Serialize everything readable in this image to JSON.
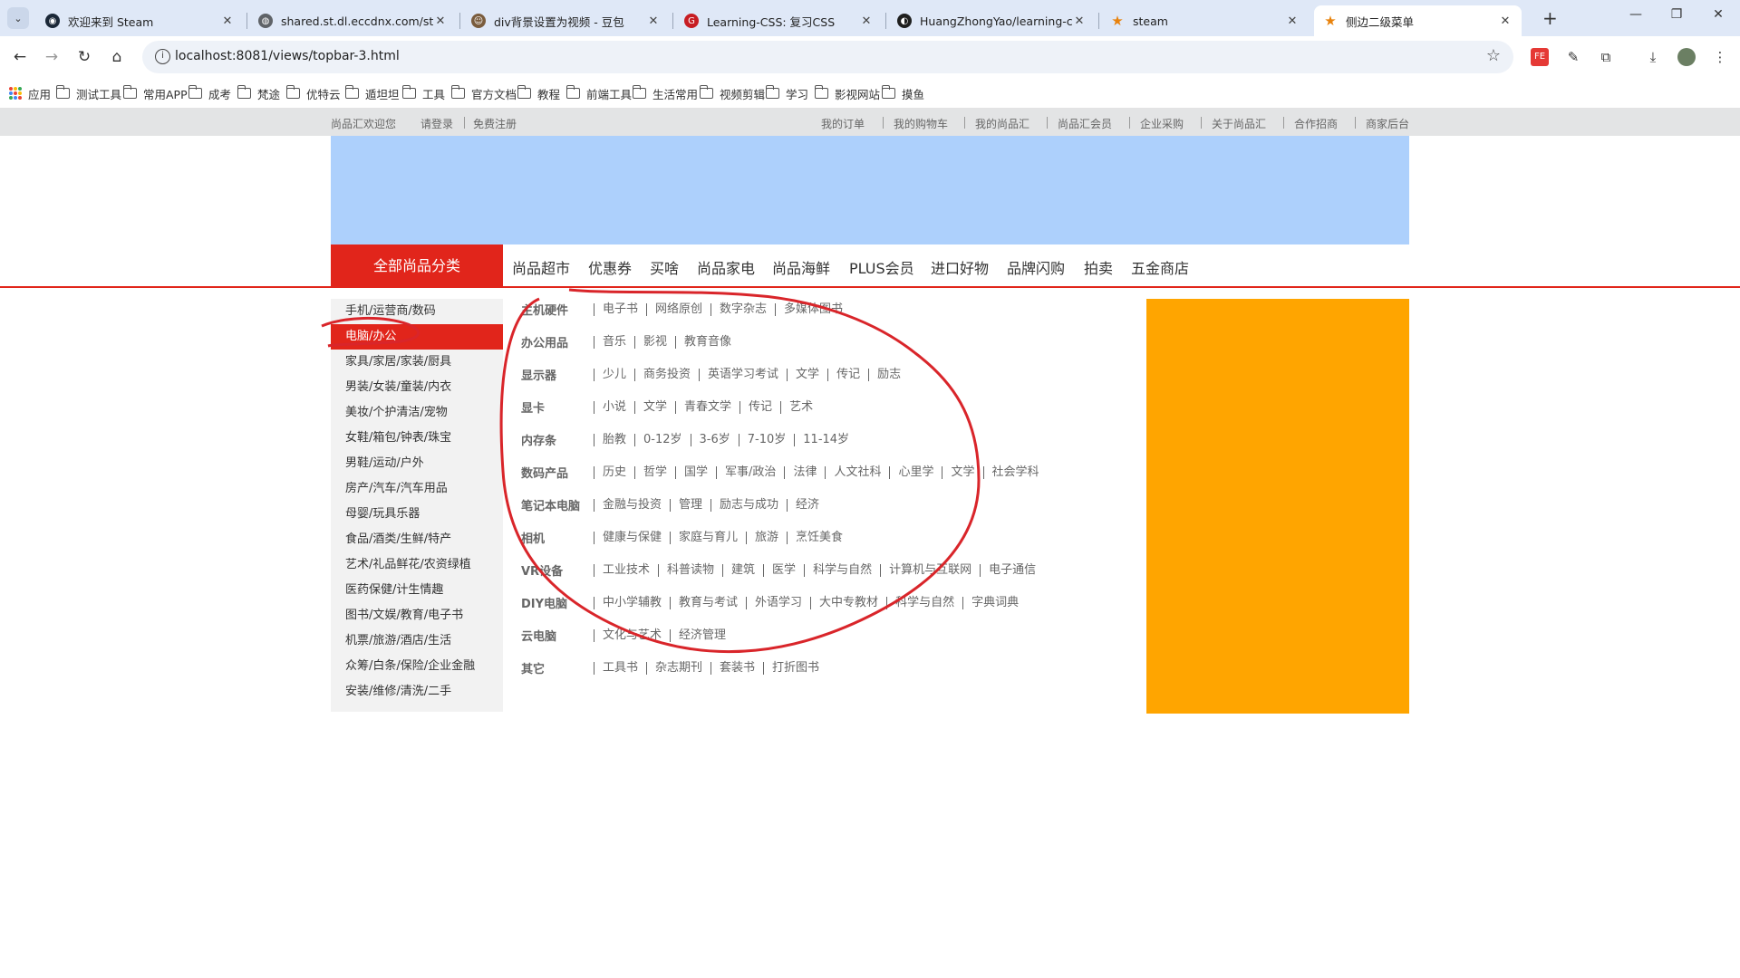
{
  "browser": {
    "tabs": [
      {
        "title": "欢迎来到 Steam",
        "icon": "steam-icon",
        "icon_color": "#1b2838"
      },
      {
        "title": "shared.st.dl.eccdnx.com/stor",
        "icon": "globe-icon",
        "icon_color": "#5f6368"
      },
      {
        "title": "div背景设置为视频 - 豆包",
        "icon": "doubao-icon",
        "icon_color": "#7a5c3d"
      },
      {
        "title": "Learning-CSS: 复习CSS",
        "icon": "gitee-icon",
        "icon_color": "#c71d23"
      },
      {
        "title": "HuangZhongYao/learning-c",
        "icon": "github-icon",
        "icon_color": "#1f1f1f"
      },
      {
        "title": "steam",
        "icon": "star-icon",
        "icon_color": "#e8820c"
      },
      {
        "title": "侧边二级菜单",
        "icon": "star-icon",
        "icon_color": "#e8820c"
      }
    ],
    "url": "localhost:8081/views/topbar-3.html",
    "bookmarks": [
      "应用",
      "测试工具",
      "常用APP",
      "成考",
      "梵途",
      "优特云",
      "遁坦坦",
      "工具",
      "官方文档",
      "教程",
      "前端工具",
      "生活常用",
      "视频剪辑",
      "学习",
      "影视网站",
      "摸鱼"
    ]
  },
  "site": {
    "topbar_left": [
      "尚品汇欢迎您",
      "请登录",
      "免费注册"
    ],
    "topbar_right": [
      "我的订单",
      "我的购物车",
      "我的尚品汇",
      "尚品汇会员",
      "企业采购",
      "关于尚品汇",
      "合作招商",
      "商家后台"
    ],
    "all_categories": "全部尚品分类",
    "nav": [
      "尚品超市",
      "优惠券",
      "买啥",
      "尚品家电",
      "尚品海鲜",
      "PLUS会员",
      "进口好物",
      "品牌闪购",
      "拍卖",
      "五金商店"
    ],
    "sidebar": [
      "手机/运营商/数码",
      "电脑/办公",
      "家具/家居/家装/厨具",
      "男装/女装/童装/内衣",
      "美妆/个护清洁/宠物",
      "女鞋/箱包/钟表/珠宝",
      "男鞋/运动/户外",
      "房产/汽车/汽车用品",
      "母婴/玩具乐器",
      "食品/酒类/生鲜/特产",
      "艺术/礼品鲜花/农资绿植",
      "医药保健/计生情趣",
      "图书/文娱/教育/电子书",
      "机票/旅游/酒店/生活",
      "众筹/白条/保险/企业金融",
      "安装/维修/清洗/二手"
    ],
    "sidebar_active_index": 1,
    "submenu": [
      {
        "title": "主机硬件",
        "items": [
          "电子书",
          "网络原创",
          "数字杂志",
          "多媒体图书"
        ]
      },
      {
        "title": "办公用品",
        "items": [
          "音乐",
          "影视",
          "教育音像"
        ]
      },
      {
        "title": "显示器",
        "items": [
          "少儿",
          "商务投资",
          "英语学习考试",
          "文学",
          "传记",
          "励志"
        ]
      },
      {
        "title": "显卡",
        "items": [
          "小说",
          "文学",
          "青春文学",
          "传记",
          "艺术"
        ]
      },
      {
        "title": "内存条",
        "items": [
          "胎教",
          "0-12岁",
          "3-6岁",
          "7-10岁",
          "11-14岁"
        ]
      },
      {
        "title": "数码产品",
        "items": [
          "历史",
          "哲学",
          "国学",
          "军事/政治",
          "法律",
          "人文社科",
          "心里学",
          "文学",
          "社会学科"
        ]
      },
      {
        "title": "笔记本电脑",
        "items": [
          "金融与投资",
          "管理",
          "励志与成功",
          "经济"
        ]
      },
      {
        "title": "相机",
        "items": [
          "健康与保健",
          "家庭与育儿",
          "旅游",
          "烹饪美食"
        ]
      },
      {
        "title": "VR设备",
        "items": [
          "工业技术",
          "科普读物",
          "建筑",
          "医学",
          "科学与自然",
          "计算机与互联网",
          "电子通信"
        ]
      },
      {
        "title": "DIY电脑",
        "items": [
          "中小学辅教",
          "教育与考试",
          "外语学习",
          "大中专教材",
          "科学与自然",
          "字典词典"
        ]
      },
      {
        "title": "云电脑",
        "items": [
          "文化与艺术",
          "经济管理"
        ]
      },
      {
        "title": "其它",
        "items": [
          "工具书",
          "杂志期刊",
          "套装书",
          "打折图书"
        ]
      }
    ]
  },
  "colors": {
    "brand_red": "#e1251b",
    "banner_blue": "#add0fc",
    "promo_orange": "#ffa500",
    "annotation_red": "#d9252a"
  }
}
